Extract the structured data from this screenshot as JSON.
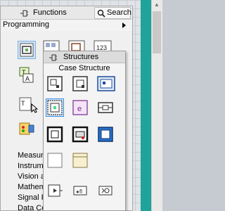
{
  "functions_palette": {
    "title": "Functions",
    "search_label": "Search",
    "category": "Programming",
    "side_items": [
      "Measure",
      "Instrume",
      "Vision a",
      "Mathem",
      "Signal P",
      "Data Co"
    ]
  },
  "structures_palette": {
    "title": "Structures",
    "hover_label": "Case Structure",
    "items": [
      "flat-sequence-icon",
      "stacked-sequence-icon",
      "timed-structure-icon",
      "case-structure-icon",
      "event-structure-icon",
      "disable-structure-icon",
      "for-loop-icon",
      "while-loop-icon",
      "timed-loop-icon",
      "shift-register-icon",
      "feedback-node-icon",
      "formula-node-icon",
      "local-variable-icon",
      "global-variable-icon",
      "shared-variable-icon"
    ]
  },
  "colors": {
    "canvas_teal": "#1fa39a",
    "selection_blue": "#3a8ee6"
  }
}
